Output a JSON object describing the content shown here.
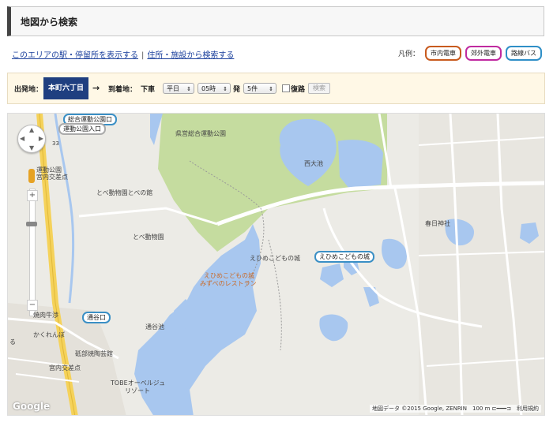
{
  "page_title": "地図から検索",
  "links": {
    "stations": "このエリアの駅・停留所を表示する",
    "separator": "|",
    "address_search": "住所・施設から検索する"
  },
  "legend": {
    "label": "凡例：",
    "items": [
      {
        "label": "市内電車",
        "color": "#c85a1e"
      },
      {
        "label": "郊外電車",
        "color": "#c02aa0"
      },
      {
        "label": "路線バス",
        "color": "#2f8fc7"
      }
    ]
  },
  "form": {
    "departure_label": "出発地：",
    "departure_value": "本町六丁目",
    "arrow": "→",
    "arrival_label": "到着地：",
    "arrival_value": "下車",
    "day_select": "平日",
    "hour_select": "05時",
    "depart_suffix": "発",
    "count_select": "5件",
    "return_label": "復路",
    "search_button": "検索"
  },
  "map": {
    "labels": {
      "park_prefectural": "県営総合運動公園",
      "nishi_pond": "西大池",
      "tobe_zoo_lib": "とべ動物園とべの館",
      "tobe_zoo": "とべ動物園",
      "kasuga_shrine": "春日神社",
      "ehime_kodomo": "えひめこどもの城",
      "ehime_kodomo_kiss": "えひめこどもの城",
      "restaurant": "みずべのレストラン",
      "tsuutani_pond": "通谷池",
      "yakiniku": "焼肉牛渉",
      "kakurenbo": "かくれんぼ",
      "tobe_ceramic": "砥部焼陶芸館",
      "miyauchi_1": "宮内交差点",
      "miyauchi_2": "宮内交差点",
      "tobe_overall": "TOBEオーベルジュ",
      "tobe_resort": "リゾート",
      "undoukouen_left": "運動公園",
      "route_33": "33",
      "shijo": "る"
    },
    "stops": {
      "sougou_park": "総合運動公園口",
      "undou_park_iriguchi": "運動公園入口",
      "ehime_kodomo_stop": "えひめこどもの城",
      "tsuutani_stop": "通谷口"
    },
    "attribution": "地図データ ©2015 Google, ZENRIN　100 m ⊏━━━⊐　利用規約",
    "google_logo": "Google"
  }
}
